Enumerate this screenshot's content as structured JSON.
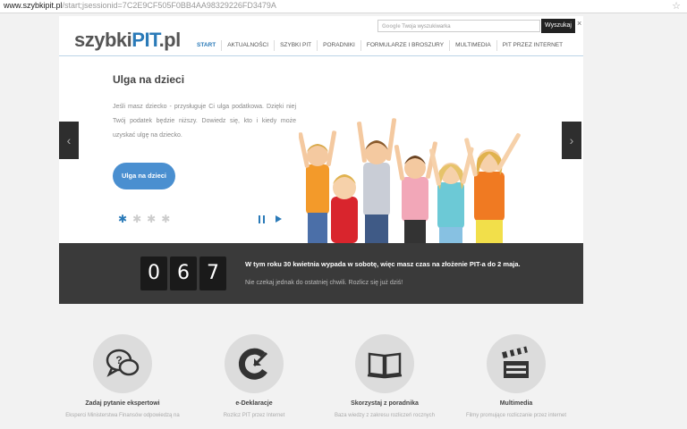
{
  "browser": {
    "url_host": "www.szybkipit.pl",
    "url_path": "/start;jsessionid=7C2E9CF505F0BB4AA98329226FD3479A"
  },
  "header": {
    "logo_part1": "szybki",
    "logo_part2": "PIT",
    "logo_part3": ".pl",
    "search_placeholder": "Twoja wyszukiwarka",
    "search_brand": "Google",
    "search_button": "Wyszukaj",
    "close_symbol": "×"
  },
  "nav": {
    "items": [
      {
        "label": "START",
        "active": true
      },
      {
        "label": "AKTUALNOŚCI",
        "active": false
      },
      {
        "label": "SZYBKI PIT",
        "active": false
      },
      {
        "label": "PORADNIKI",
        "active": false
      },
      {
        "label": "FORMULARZE I BROSZURY",
        "active": false
      },
      {
        "label": "MULTIMEDIA",
        "active": false
      },
      {
        "label": "PIT PRZEZ INTERNET",
        "active": false
      }
    ]
  },
  "hero": {
    "title": "Ulga na dzieci",
    "text": "Jeśli masz dziecko - przysługuje Ci ulga podatkowa. Dzięki niej Twój podatek będzie niższy. Dowiedz się, kto i kiedy może uzyskać ulgę na dziecko.",
    "button": "Ulga na dzieci",
    "slides_total": 4,
    "slide_active": 1
  },
  "countdown": {
    "digits": [
      "0",
      "6",
      "7"
    ],
    "main_text": "W tym roku 30 kwietnia wypada w sobotę, więc masz czas na złożenie PIT-a do 2 maja.",
    "sub_text": "Nie czekaj jednak do ostatniej chwili. Rozlicz się już dziś!"
  },
  "features": [
    {
      "title": "Zadaj pytanie ekspertowi",
      "desc": "Eksperci Ministerstwa Finansów odpowiedzą na",
      "icon": "chat-bubbles-icon"
    },
    {
      "title": "e-Deklaracje",
      "desc": "Rozlicz PIT przez Internet",
      "icon": "e-deklaracje-icon"
    },
    {
      "title": "Skorzystaj z poradnika",
      "desc": "Baza wiedzy z zakresu rozliczeń rocznych",
      "icon": "book-icon"
    },
    {
      "title": "Multimedia",
      "desc": "Filmy promujące rozliczanie przez internet",
      "icon": "clapperboard-icon"
    }
  ],
  "colors": {
    "accent": "#2a7ab8",
    "button": "#4a8fd0",
    "dark_band": "#3a3a3a"
  }
}
